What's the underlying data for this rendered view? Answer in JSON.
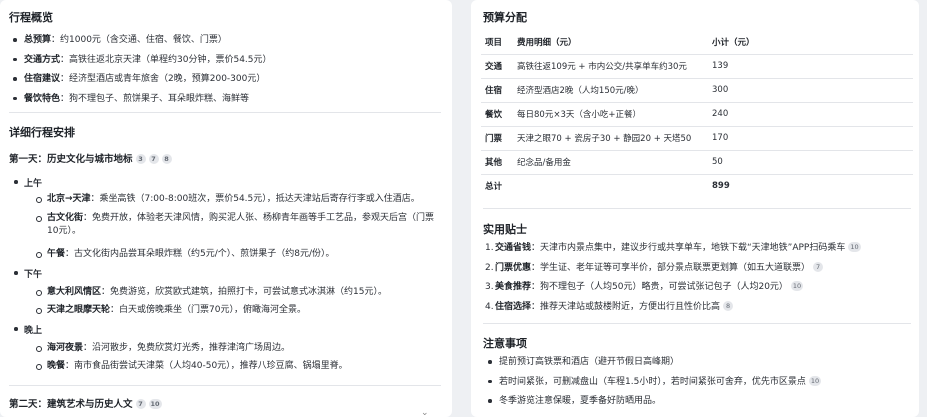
{
  "left": {
    "overview_title": "行程概览",
    "overview": [
      {
        "label": "总预算",
        "text": "：约1000元（含交通、住宿、餐饮、门票）"
      },
      {
        "label": "交通方式",
        "text": "：高铁往返北京天津（单程约30分钟，票价54.5元）"
      },
      {
        "label": "住宿建议",
        "text": "：经济型酒店或青年旅舍（2晚，预算200-300元）"
      },
      {
        "label": "餐饮特色",
        "text": "：狗不理包子、煎饼果子、耳朵眼炸糕、海鲜等"
      }
    ],
    "detail_title": "详细行程安排",
    "day1": {
      "title": "第一天：历史文化与城市地标",
      "cites": [
        "3",
        "7",
        "8"
      ]
    },
    "morning_label": "上午",
    "morning": [
      {
        "label": "北京→天津",
        "text": "：乘坐高铁（7:00-8:00班次，票价54.5元），抵达天津站后寄存行李或入住酒店。",
        "cite": ""
      },
      {
        "label": "古文化街",
        "text": "：免费开放，体验老天津风情，购买泥人张、杨柳青年画等手工艺品，参观天后宫（门票",
        "cont": "10元）。",
        "cite": ""
      },
      {
        "label": "午餐",
        "text": "：古文化街内品尝耳朵眼炸糕（约5元/个）、煎饼果子（约8元/份）。",
        "cite": ""
      }
    ],
    "afternoon_label": "下午",
    "afternoon": [
      {
        "label": "意大利风情区",
        "text": "：免费游览，欣赏欧式建筑，拍照打卡，可尝试意式冰淇淋（约15元）。"
      },
      {
        "label": "天津之眼摩天轮",
        "text": "：白天或傍晚乘坐（门票70元），俯瞰海河全景。"
      }
    ],
    "evening_label": "晚上",
    "evening": [
      {
        "label": "海河夜景",
        "text": "：沿河散步，免费欣赏灯光秀，推荐津湾广场周边。"
      },
      {
        "label": "晚餐",
        "text": "：南市食品街尝试天津菜（人均40-50元），推荐八珍豆腐、锅塌里脊。"
      }
    ],
    "day2": {
      "title": "第二天：建筑艺术与历史人文",
      "cites": [
        "7",
        "10"
      ]
    },
    "scroll_glyph": "⌄"
  },
  "right": {
    "budget_title": "预算分配",
    "budget_headers": [
      "项目",
      "费用明细（元）",
      "小计（元）"
    ],
    "budget_rows": [
      {
        "cat": "交通",
        "detail": "高铁往返109元 + 市内公交/共享单车约30元",
        "sub": "139"
      },
      {
        "cat": "住宿",
        "detail": "经济型酒店2晚（人均150元/晚）",
        "sub": "300"
      },
      {
        "cat": "餐饮",
        "detail": "每日80元×3天（含小吃+正餐）",
        "sub": "240"
      },
      {
        "cat": "门票",
        "detail": "天津之眼70 + 瓷房子30 + 静园20 + 天塔50",
        "sub": "170"
      },
      {
        "cat": "其他",
        "detail": "纪念品/备用金",
        "sub": "50"
      }
    ],
    "budget_total": {
      "cat": "总计",
      "detail": "",
      "sub": "899"
    },
    "tips_title": "实用贴士",
    "tips": [
      {
        "num": "1.",
        "label": "交通省钱",
        "text": "：天津市内景点集中，建议步行或共享单车，地铁下载“天津地铁”APP扫码乘车",
        "cite": "10"
      },
      {
        "num": "2.",
        "label": "门票优惠",
        "text": "：学生证、老年证等可享半价，部分景点联票更划算（如五大道联票）",
        "cite": "7"
      },
      {
        "num": "3.",
        "label": "美食推荐",
        "text": "：狗不理包子（人均50元）略贵，可尝试张记包子（人均20元）",
        "cite": "10"
      },
      {
        "num": "4.",
        "label": "住宿选择",
        "text": "：推荐天津站或鼓楼附近，方便出行且性价比高",
        "cite": "8"
      }
    ],
    "notes_title": "注意事项",
    "notes": [
      {
        "text": "提前预订高铁票和酒店（避开节假日高峰期）",
        "cite": ""
      },
      {
        "text": "若时间紧张，可删减盘山（车程1.5小时），若时间紧张可舍弃，优先市区景点",
        "cite": "10"
      },
      {
        "text": "冬季游览注意保暖，夏季备好防晒用品。",
        "cite": ""
      }
    ]
  }
}
